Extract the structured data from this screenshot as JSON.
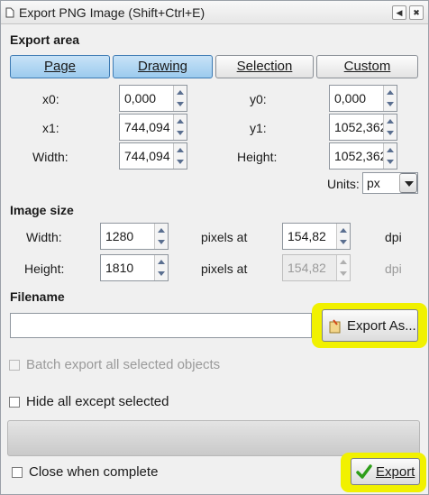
{
  "window": {
    "title": "Export PNG Image (Shift+Ctrl+E)",
    "icons": [
      "png-file-icon",
      "dock-icon",
      "close-icon"
    ]
  },
  "export_area": {
    "heading": "Export area",
    "tabs": [
      {
        "label": "Page",
        "active": true
      },
      {
        "label": "Drawing",
        "active": true
      },
      {
        "label": "Selection",
        "active": false
      },
      {
        "label": "Custom",
        "active": false
      }
    ],
    "x0_label": "x0:",
    "x0_value": "0,000",
    "y0_label": "y0:",
    "y0_value": "0,000",
    "x1_label": "x1:",
    "x1_value": "744,094",
    "y1_label": "y1:",
    "y1_value": "1052,362",
    "width_label": "Width:",
    "width_value": "744,094",
    "height_label": "Height:",
    "height_value": "1052,362",
    "units_label": "Units:",
    "units_value": "px"
  },
  "image_size": {
    "heading": "Image size",
    "width_label": "Width:",
    "width_value": "1280",
    "height_label": "Height:",
    "height_value": "1810",
    "pixels_at_1": "pixels at",
    "pixels_at_2": "pixels at",
    "dpi_value_1": "154,82",
    "dpi_value_2": "154,82",
    "dpi_label_1": "dpi",
    "dpi_label_2": "dpi"
  },
  "filename": {
    "heading": "Filename",
    "value": "",
    "export_as_label": "Export As..."
  },
  "options": {
    "batch_label": "Batch export all selected objects",
    "hide_label": "Hide all except selected",
    "close_label": "Close when complete"
  },
  "actions": {
    "export_label": "Export"
  },
  "colors": {
    "highlight": "#f1f100",
    "active_tab": "#b4d8f4",
    "export_check": "#2e9e1a"
  }
}
